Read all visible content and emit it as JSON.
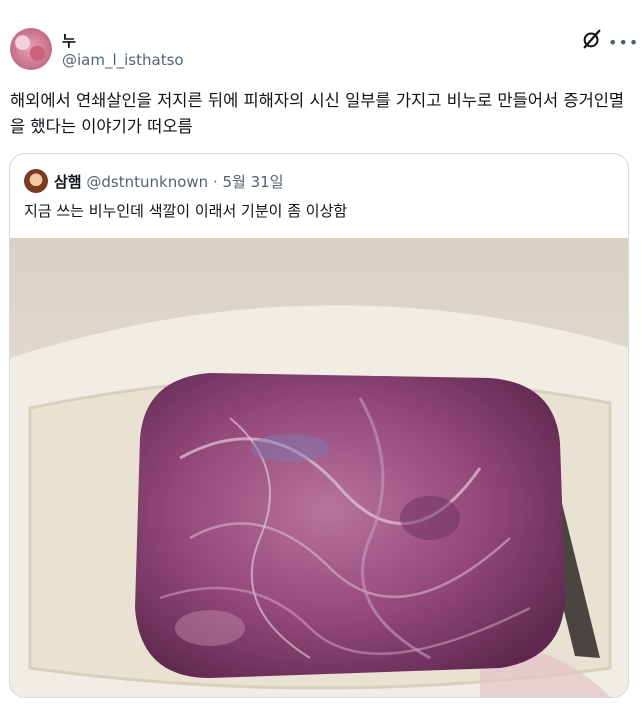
{
  "tweet": {
    "author_name": "누",
    "author_handle": "@iam_l_isthatso",
    "text": "해외에서 연쇄살인을 저지른 뒤에 피해자의 시신 일부를 가지고 비누로 만들어서 증거인멸을 했다는 이야기가 떠오름"
  },
  "quote": {
    "author_name": "삼햄",
    "author_handle": "@dstntunknown",
    "separator": "·",
    "date": "5월 31일",
    "text": "지금 쓰는 비누인데 색깔이 이래서 기분이 좀 이상함"
  },
  "icons": {
    "grok": "grok-icon",
    "more": "more-options-icon"
  },
  "colors": {
    "text_primary": "#0f1419",
    "text_secondary": "#536471",
    "border": "#cfd9de",
    "soap": "#9a4e7a",
    "dish": "#ece4d3"
  }
}
